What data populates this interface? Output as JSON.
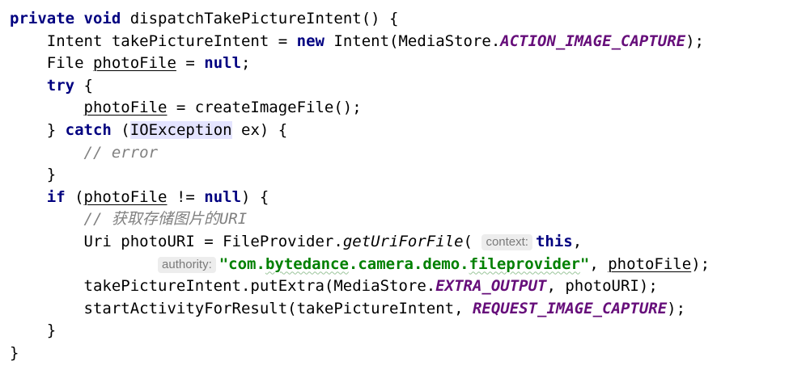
{
  "code": {
    "l1": {
      "kw": "private void",
      "sig": " dispatchTakePictureIntent() {"
    },
    "l2": {
      "pre": "Intent takePictureIntent = ",
      "kw": "new",
      "mid": " Intent(MediaStore.",
      "const": "ACTION_IMAGE_CAPTURE",
      "end": ");"
    },
    "l3": {
      "pre": "File ",
      "var": "photoFile",
      "mid": " = ",
      "kw": "null",
      "end": ";"
    },
    "l4": {
      "kw": "try",
      "end": " {"
    },
    "l5": {
      "var": "photoFile",
      "end": " = createImageFile();"
    },
    "l6": {
      "pre": "} ",
      "kw": "catch",
      "mid": " (",
      "hl": "IOException",
      "end": " ex) {"
    },
    "l7": {
      "comment": "// error"
    },
    "l8": {
      "text": "}"
    },
    "l9": {
      "kw": "if",
      "mid": " (",
      "var": "photoFile",
      "mid2": " != ",
      "kw2": "null",
      "end": ") {"
    },
    "l10": {
      "comment": "// 获取存储图片的URI"
    },
    "l11": {
      "pre": "Uri photoURI = FileProvider.",
      "static": "getUriForFile",
      "paren": "(",
      "hint": "context:",
      "kw": "this",
      "end": ","
    },
    "l12": {
      "hint": "authority:",
      "str_a": "\"com.",
      "str_b": "bytedance",
      "str_c": ".camera.demo.",
      "str_d": "fileprovider",
      "str_e": "\"",
      "mid": ", ",
      "var": "photoFile",
      "end": ");"
    },
    "l13": {
      "pre": "takePictureIntent.putExtra(MediaStore.",
      "const": "EXTRA_OUTPUT",
      "end": ", photoURI);"
    },
    "l14": {
      "pre": "startActivityForResult(takePictureIntent, ",
      "const": "REQUEST_IMAGE_CAPTURE",
      "end": ");"
    },
    "l15": {
      "text": "}"
    },
    "l16": {
      "text": "}"
    }
  }
}
